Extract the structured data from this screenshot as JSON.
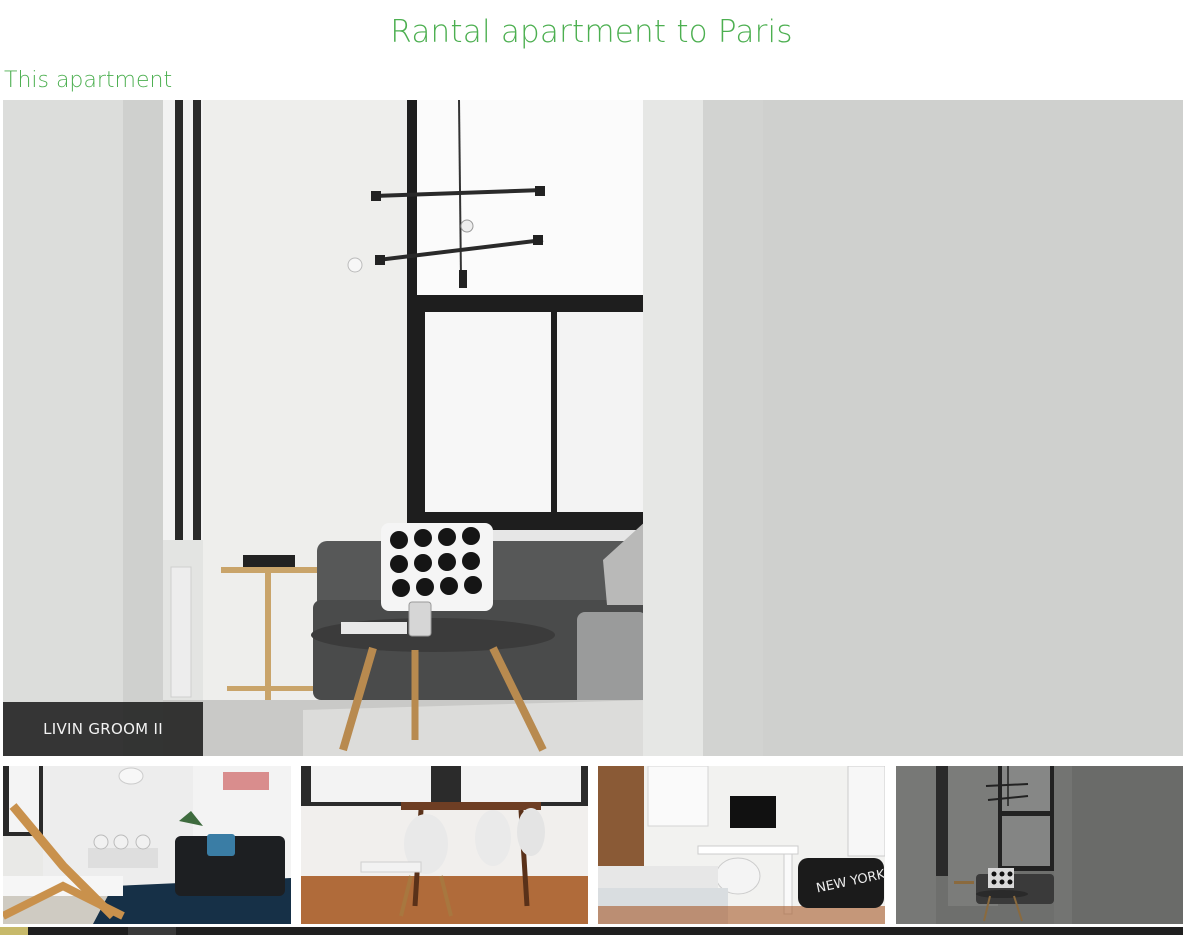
{
  "page": {
    "title": "Rantal apartment to Paris",
    "subtitle": "This apartment"
  },
  "gallery": {
    "main_caption": "LIVIN GROOM II",
    "thumbnails": [
      {
        "name": "living-room-chair-sofa"
      },
      {
        "name": "dining-table-chairs"
      },
      {
        "name": "bedroom-desk",
        "pillow_text": "NEW YORK"
      },
      {
        "name": "living-room-ii"
      }
    ]
  },
  "colors": {
    "accent_green": "#4caf50",
    "caption_bg": "#1e1e1e"
  }
}
